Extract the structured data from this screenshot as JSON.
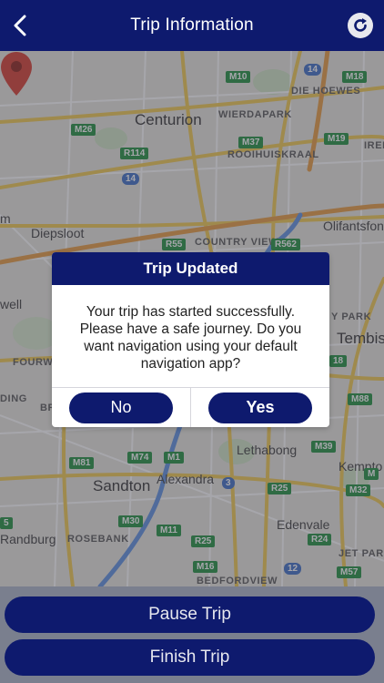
{
  "header": {
    "title": "Trip Information",
    "back_icon": "chevron-left-icon",
    "refresh_icon": "refresh-icon"
  },
  "map": {
    "places": {
      "centurion": "Centurion",
      "wierdapark": "WIERDAPARK",
      "die_hoewes": "DIE HOEWES",
      "rooihuiskraal": "ROOIHUISKRAAL",
      "irene": "IREN",
      "diepsloot": "Diepsloot",
      "country_view": "COUNTRY VIEW",
      "olifantsfon": "Olifantsfon",
      "well": "well",
      "park": "Y PARK",
      "tembis": "Tembis",
      "fourw": "FOURW",
      "ding": "DING",
      "br": "BR",
      "lethabong": "Lethabong",
      "alexandra": "Alexandra",
      "sandton": "Sandton",
      "kempto": "Kempto",
      "randburg": "Randburg",
      "rosebank": "ROSEBANK",
      "edenvale": "Edenvale",
      "jet_par": "JET PAR",
      "bedfordview": "BEDFORDVIEW",
      "m": "m"
    },
    "shields": {
      "m10": "M10",
      "r14": "14",
      "m18": "M18",
      "m26": "M26",
      "m37": "M37",
      "m19": "M19",
      "r114": "R114",
      "r14b": "14",
      "r55": "R55",
      "r562": "R562",
      "r18": "18",
      "m88": "M88",
      "m39": "M39",
      "m74": "M74",
      "m81": "M81",
      "m1": "M1",
      "r3": "3",
      "r25": "R25",
      "m32": "M32",
      "m30": "M30",
      "m11": "M11",
      "r25b": "R25",
      "r24": "R24",
      "m16": "M16",
      "r12": "12",
      "m57": "M57",
      "m9": "M",
      "m5": "5"
    },
    "pin_icon": "map-pin-icon",
    "colors": {
      "route": "#5b8fe0",
      "pin": "#d6392b",
      "major_road": "#f2c94c"
    }
  },
  "dialog": {
    "title": "Trip Updated",
    "message": "Your trip has started successfully. Please have a safe journey. Do you want navigation using your default navigation app?",
    "no_label": "No",
    "yes_label": "Yes"
  },
  "actions": {
    "pause_label": "Pause Trip",
    "finish_label": "Finish Trip"
  },
  "colors": {
    "primary": "#0e1a6e"
  }
}
